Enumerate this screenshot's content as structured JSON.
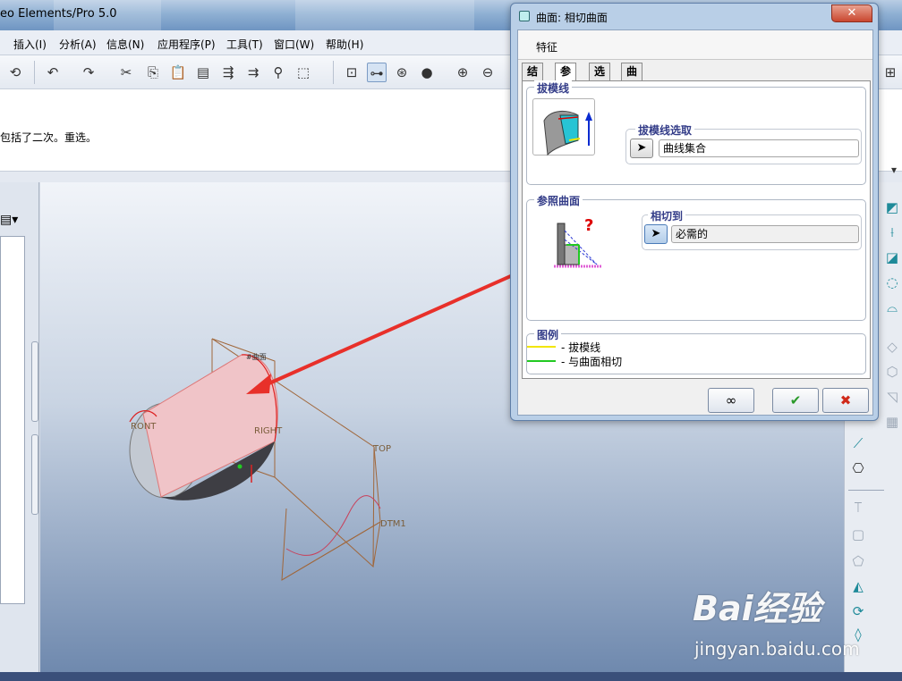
{
  "window": {
    "title": "eo Elements/Pro 5.0"
  },
  "menu": {
    "items": [
      "插入(I)",
      "分析(A)",
      "信息(N)",
      "应用程序(P)",
      "工具(T)",
      "窗口(W)",
      "帮助(H)"
    ]
  },
  "message": {
    "text": "包括了二次。重选。"
  },
  "model": {
    "labels": {
      "front": "RONT",
      "right": "RIGHT",
      "top": "TOP",
      "dtm": "DTM1",
      "surface": "#曲面"
    }
  },
  "dialog": {
    "title": "曲面: 相切曲面",
    "feature_label": "特征",
    "tabs": [
      "结果",
      "参照",
      "选项",
      "曲线"
    ],
    "active_tab": "参照",
    "draft_group": {
      "label": "拔模线",
      "select_label": "拔模线选取",
      "select_value": "曲线集合"
    },
    "ref_group": {
      "label": "参照曲面",
      "tangent_label": "相切到",
      "tangent_value": "必需的"
    },
    "legend": {
      "label": "图例",
      "items": [
        {
          "text": "- 拔模线",
          "color": "#f2e600"
        },
        {
          "text": "- 与曲面相切",
          "color": "#22c922"
        }
      ]
    },
    "buttons": {
      "preview_icon": "glasses-icon",
      "ok_icon": "check-icon",
      "cancel_icon": "x-icon"
    }
  },
  "watermark": {
    "logo": "Bai经验",
    "url": "jingyan.baidu.com"
  },
  "colors": {
    "accent_arrow": "#e8302a",
    "ok_green": "#2a9a2a",
    "cancel_red": "#d02a1a"
  }
}
